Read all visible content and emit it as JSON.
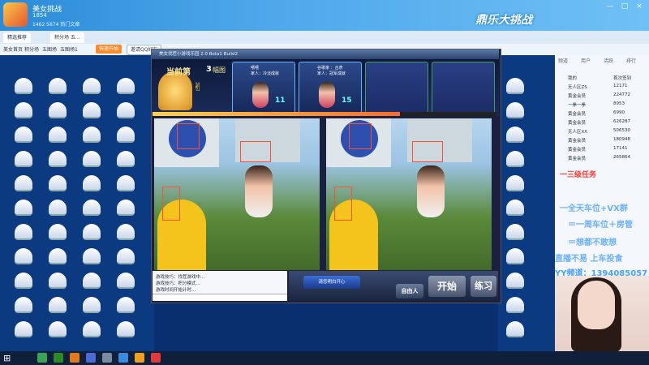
{
  "window": {
    "title": "美女挑战",
    "user_id": "1854",
    "stats": "1462   5674   热门文章",
    "min": "—",
    "max": "□",
    "close": "×"
  },
  "banner": {
    "text": "鼎乐大挑战"
  },
  "tabs": [
    {
      "label": "精选推荐"
    },
    {
      "label": "积分场 五..."
    }
  ],
  "breadcrumb": {
    "items": [
      "美女首页",
      "积分场",
      "五图场",
      "五图场1"
    ],
    "btn1": "快速开始",
    "btn2": "邀请QQ好友"
  },
  "game": {
    "window_title": "美女找茬小游戏乐园 2.0 Beta1 Build2",
    "round_label": "当前第",
    "round_num": "3",
    "round_suffix": "幅图",
    "players": [
      {
        "name": "嘻嘻",
        "line2": "家人：冷淡成就",
        "line3": "冷淡成就",
        "score": "11"
      },
      {
        "name": "谷歌家 ：合彦",
        "line2": "家人：冠军成就",
        "line3": "冠军成就",
        "score": "15"
      }
    ],
    "progress": 0.72,
    "chat": [
      "游戏技巧：找茬游戏中...",
      "游戏技巧：积分模式...",
      "游戏时间开始计时..."
    ],
    "ready_label": "请您明白开心",
    "buttons": {
      "free": "自由人",
      "start": "开始",
      "practice": "练习"
    }
  },
  "right_panel": {
    "tabs": [
      "频道",
      "用户",
      "活跃",
      "排行"
    ],
    "users": [
      {
        "name": "我的",
        "role": "首次签到"
      },
      {
        "name": "无人区ZS",
        "value": "12171"
      },
      {
        "name": "黄金会员",
        "value": "224772"
      },
      {
        "name": "一拳一拳",
        "value": "8953"
      },
      {
        "name": "黄金会员",
        "value": "6990"
      },
      {
        "name": "黄金会员",
        "value": "626287"
      },
      {
        "name": "无人区XX",
        "value": "506530"
      },
      {
        "name": "黄金会员",
        "value": "180948"
      },
      {
        "name": "黄金会员",
        "value": "17141"
      },
      {
        "name": "黄金会员",
        "value": "265864"
      }
    ],
    "overlays": [
      {
        "text": "一三级任务"
      },
      {
        "text": "一全天车位+VX群"
      },
      {
        "text": "＝一周车位＋房管"
      },
      {
        "text": "＝想都不敢想"
      },
      {
        "text": "直播不易 上车投食"
      },
      {
        "text": "YY频道：1394085057"
      }
    ]
  },
  "taskbar": {
    "time": ""
  },
  "colors": {
    "accent": "#ffd24a",
    "overlay_red": "#ff3b30",
    "overlay_blue": "#6ab0ff",
    "start_btn": "#ff8c1a"
  }
}
